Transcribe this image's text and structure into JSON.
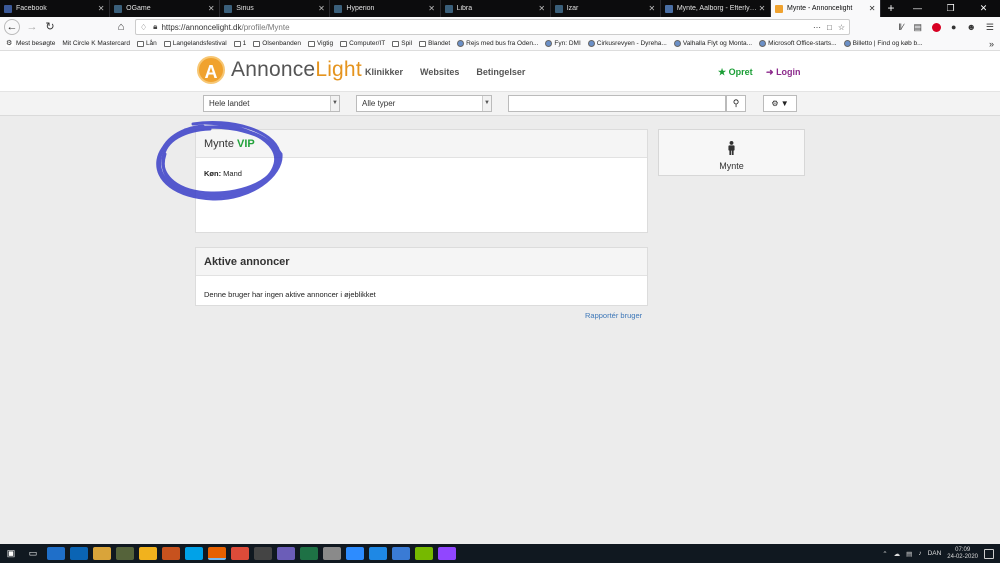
{
  "browser": {
    "tabs": [
      {
        "title": "Facebook",
        "icon": "facebook-icon",
        "color": "#3b5998",
        "active": false
      },
      {
        "title": "OGame",
        "icon": "ogame-icon",
        "color": "#3a5f7a",
        "active": false
      },
      {
        "title": "Sirius",
        "icon": "ogame-icon",
        "color": "#3a5f7a",
        "active": false
      },
      {
        "title": "Hyperion",
        "icon": "ogame-icon",
        "color": "#3a5f7a",
        "active": false
      },
      {
        "title": "Libra",
        "icon": "ogame-icon",
        "color": "#3a5f7a",
        "active": false
      },
      {
        "title": "Izar",
        "icon": "ogame-icon",
        "color": "#3a5f7a",
        "active": false
      },
      {
        "title": "Mynte, Aalborg - Efterlysning",
        "icon": "profile-icon",
        "color": "#4a6fa5",
        "active": false
      },
      {
        "title": "Mynte - Annoncelight",
        "icon": "annoncelight-icon",
        "color": "#f0a22e",
        "active": true
      }
    ],
    "url_host": "https://annoncelight.dk",
    "url_path": "/profile/Mynte",
    "bookmarks": [
      {
        "label": "Mest besøgte",
        "icon": "gear-icon"
      },
      {
        "label": "Mit Circle K Mastercard",
        "icon": "none"
      },
      {
        "label": "Lån",
        "icon": "folder-icon"
      },
      {
        "label": "Langelandsfestival",
        "icon": "folder-icon"
      },
      {
        "label": "1",
        "icon": "folder-icon"
      },
      {
        "label": "Olsenbanden",
        "icon": "folder-icon"
      },
      {
        "label": "Vigtig",
        "icon": "folder-icon"
      },
      {
        "label": "Computer/IT",
        "icon": "folder-icon"
      },
      {
        "label": "Spil",
        "icon": "folder-icon"
      },
      {
        "label": "Blandet",
        "icon": "folder-icon"
      },
      {
        "label": "Rejs med bus fra Oden...",
        "icon": "bus-icon"
      },
      {
        "label": "Fyn: DMI",
        "icon": "dmi-icon"
      },
      {
        "label": "Cirkusrevyen - Dyreha...",
        "icon": "circus-icon"
      },
      {
        "label": "Valhalla Flyt og Monta...",
        "icon": "valhalla-icon"
      },
      {
        "label": "Microsoft Office-starts...",
        "icon": "office-icon"
      },
      {
        "label": "Billetto | Find og køb b...",
        "icon": "billetto-icon"
      }
    ]
  },
  "site": {
    "logo_letter": "A",
    "logo_part1": "Annonce",
    "logo_part2": "Light",
    "nav": [
      "Klinikker",
      "Websites",
      "Betingelser"
    ],
    "opret_label": "Opret",
    "login_label": "Login",
    "accent_color": "#f0a22e"
  },
  "filters": {
    "region": "Hele landet",
    "type": "Alle typer",
    "search_value": ""
  },
  "profile": {
    "name": "Mynte",
    "badge": "VIP",
    "gender_label": "Køn:",
    "gender_value": "Mand"
  },
  "ads": {
    "title": "Aktive annoncer",
    "empty_text": "Denne bruger har ingen aktive annoncer i øjeblikket"
  },
  "report_label": "Rapportér bruger",
  "taskbar": {
    "language": "DAN",
    "time": "07:09",
    "date": "24-02-2020"
  }
}
